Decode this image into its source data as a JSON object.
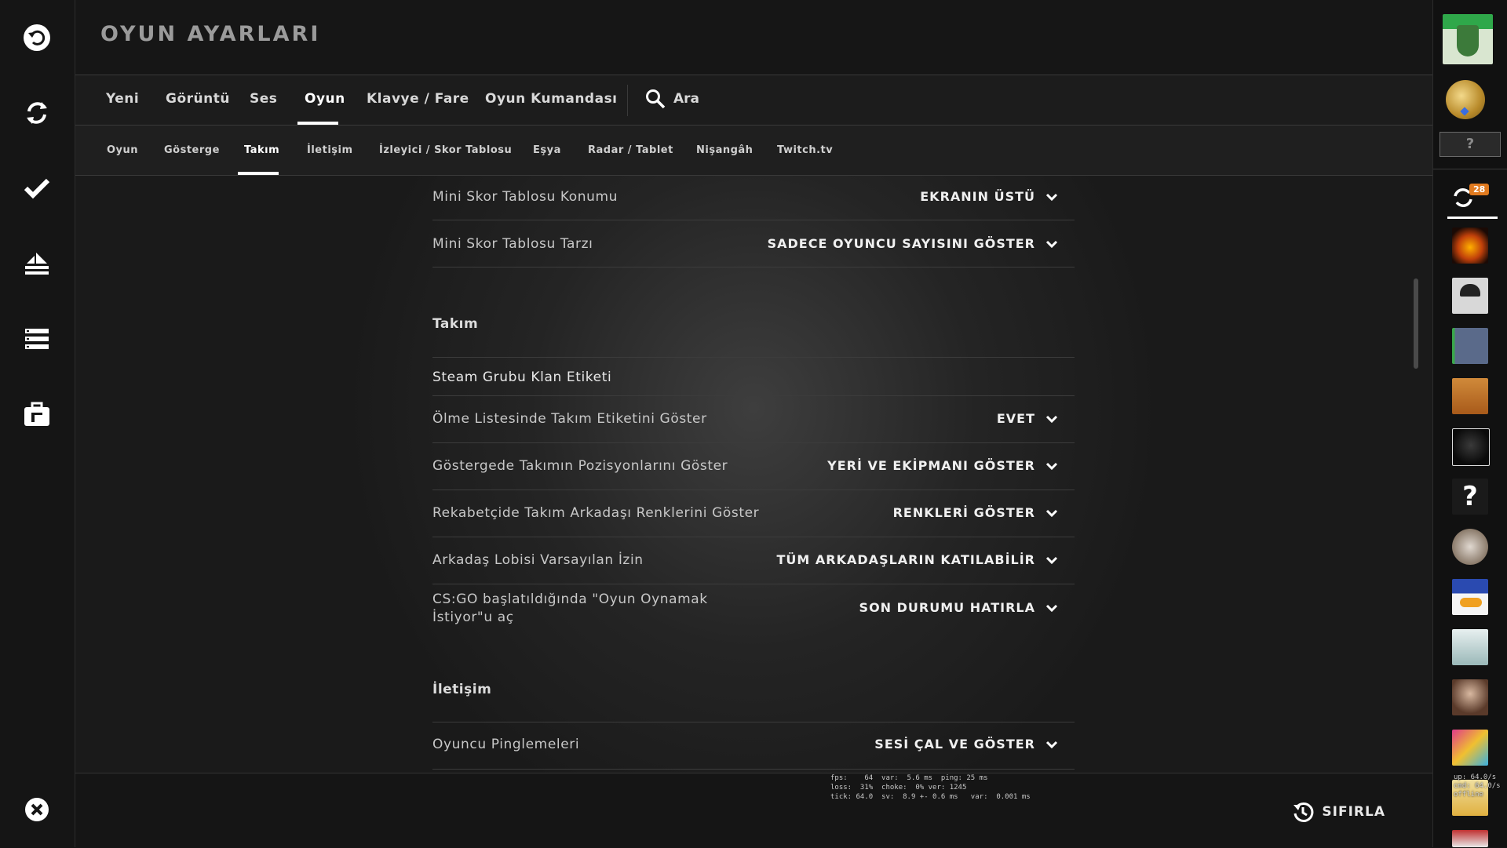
{
  "header": {
    "title": "OYUN AYARLARI"
  },
  "tabs": [
    {
      "label": "Yeni"
    },
    {
      "label": "Görüntü"
    },
    {
      "label": "Ses"
    },
    {
      "label": "Oyun"
    },
    {
      "label": "Klavye / Fare"
    },
    {
      "label": "Oyun Kumandası"
    }
  ],
  "search": {
    "label": "Ara"
  },
  "subtabs": [
    {
      "label": "Oyun"
    },
    {
      "label": "Gösterge"
    },
    {
      "label": "Takım"
    },
    {
      "label": "İletişim"
    },
    {
      "label": "İzleyici / Skor Tablosu"
    },
    {
      "label": "Eşya"
    },
    {
      "label": "Radar / Tablet"
    },
    {
      "label": "Nişangâh"
    },
    {
      "label": "Twitch.tv"
    }
  ],
  "settings": {
    "mini_scoreboard_position": {
      "label": "Mini Skor Tablosu Konumu",
      "value": "EKRANIN ÜSTÜ"
    },
    "mini_scoreboard_style": {
      "label": "Mini Skor Tablosu Tarzı",
      "value": "SADECE OYUNCU SAYISINI GÖSTER"
    },
    "team_section": {
      "title": "Takım"
    },
    "steam_group_clan_tag": {
      "label": "Steam Grubu Klan Etiketi"
    },
    "killfeed_team_tag": {
      "label": "Ölme Listesinde Takım Etiketini Göster",
      "value": "EVET"
    },
    "hud_team_positions": {
      "label": "Göstergede Takımın Pozisyonlarını Göster",
      "value": "YERİ VE EKİPMANI GÖSTER"
    },
    "competitive_teammate_colors": {
      "label": "Rekabetçide Takım Arkadaşı Renklerini Göster",
      "value": "RENKLERİ GÖSTER"
    },
    "friend_lobby_permission": {
      "label": "Arkadaş Lobisi Varsayılan İzin",
      "value": "TÜM ARKADAŞLARIN KATILABİLİR"
    },
    "looking_to_play_on_launch": {
      "label_line1": "CS:GO başlatıldığında \"Oyun Oynamak",
      "label_line2": "İstiyor\"u aç",
      "value": "SON DURUMU HATIRLA"
    },
    "communication_section": {
      "title": "İletişim"
    },
    "player_pings": {
      "label": "Oyuncu Pinglemeleri",
      "value": "SESİ ÇAL VE GÖSTER"
    }
  },
  "netgraph": {
    "line1": "fps:    64  var:  5.6 ms  ping: 25 ms",
    "line2": "loss:  31%  choke:  0% ver: 1245",
    "line3": "tick: 64.0  sv:  8.9 +- 0.6 ms   var:  0.001 ms",
    "right1": "up: 64.0/s",
    "right2": "cmd: 64.0/s",
    "right3": "offline"
  },
  "footer": {
    "reset_label": "SIFIRLA"
  },
  "friends": {
    "count_badge": "28",
    "unknown_label": "?"
  },
  "colors": {
    "accent": "#ffffff",
    "badge": "#e07a1f",
    "background": "#1a1a1a"
  }
}
